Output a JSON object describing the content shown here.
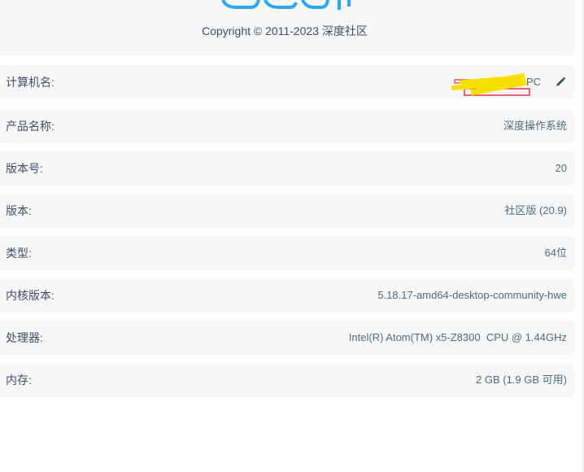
{
  "header": {
    "copyright": "Copyright © 2011-2023 深度社区",
    "logo_color": "#2ca7f8"
  },
  "rows": [
    {
      "label": "计算机名:",
      "value": "PC"
    },
    {
      "label": "产品名称:",
      "value": "深度操作系统"
    },
    {
      "label": "版本号:",
      "value": "20"
    },
    {
      "label": "版本:",
      "value": "社区版 (20.9)"
    },
    {
      "label": "类型:",
      "value": "64位"
    },
    {
      "label": "内核版本:",
      "value": "5.18.17-amd64-desktop-community-hwe"
    },
    {
      "label": "处理器:",
      "value": "Intel(R) Atom(TM) x5-Z8300  CPU @ 1.44GHz"
    },
    {
      "label": "内存:",
      "value": "2 GB (1.9 GB 可用)"
    }
  ],
  "icons": {
    "edit": "pencil-icon"
  },
  "colors": {
    "card_bg": "#f7f7f7",
    "text": "#414d68",
    "redaction_yellow": "#f7e000",
    "redaction_red": "#e8304a"
  }
}
